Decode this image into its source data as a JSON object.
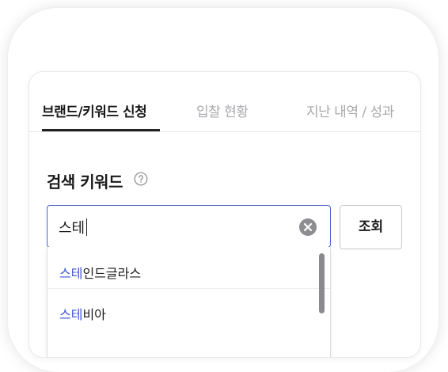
{
  "tabs": [
    {
      "label": "브랜드/키워드 신청",
      "active": true
    },
    {
      "label": "입찰 현황",
      "active": false
    },
    {
      "label": "지난 내역 / 성과",
      "active": false
    }
  ],
  "search_section": {
    "title": "검색 키워드",
    "help_icon": "question-circle-icon"
  },
  "search": {
    "value": "스테",
    "clear_icon": "clear-x-icon",
    "button_label": "조회"
  },
  "suggestions": [
    {
      "match": "스테",
      "rest": "인드글라스"
    },
    {
      "match": "스테",
      "rest": "비아"
    }
  ],
  "colors": {
    "accent": "#4a5fd1",
    "match_text": "#3f56d6",
    "inactive_tab": "#a8a8ae"
  }
}
